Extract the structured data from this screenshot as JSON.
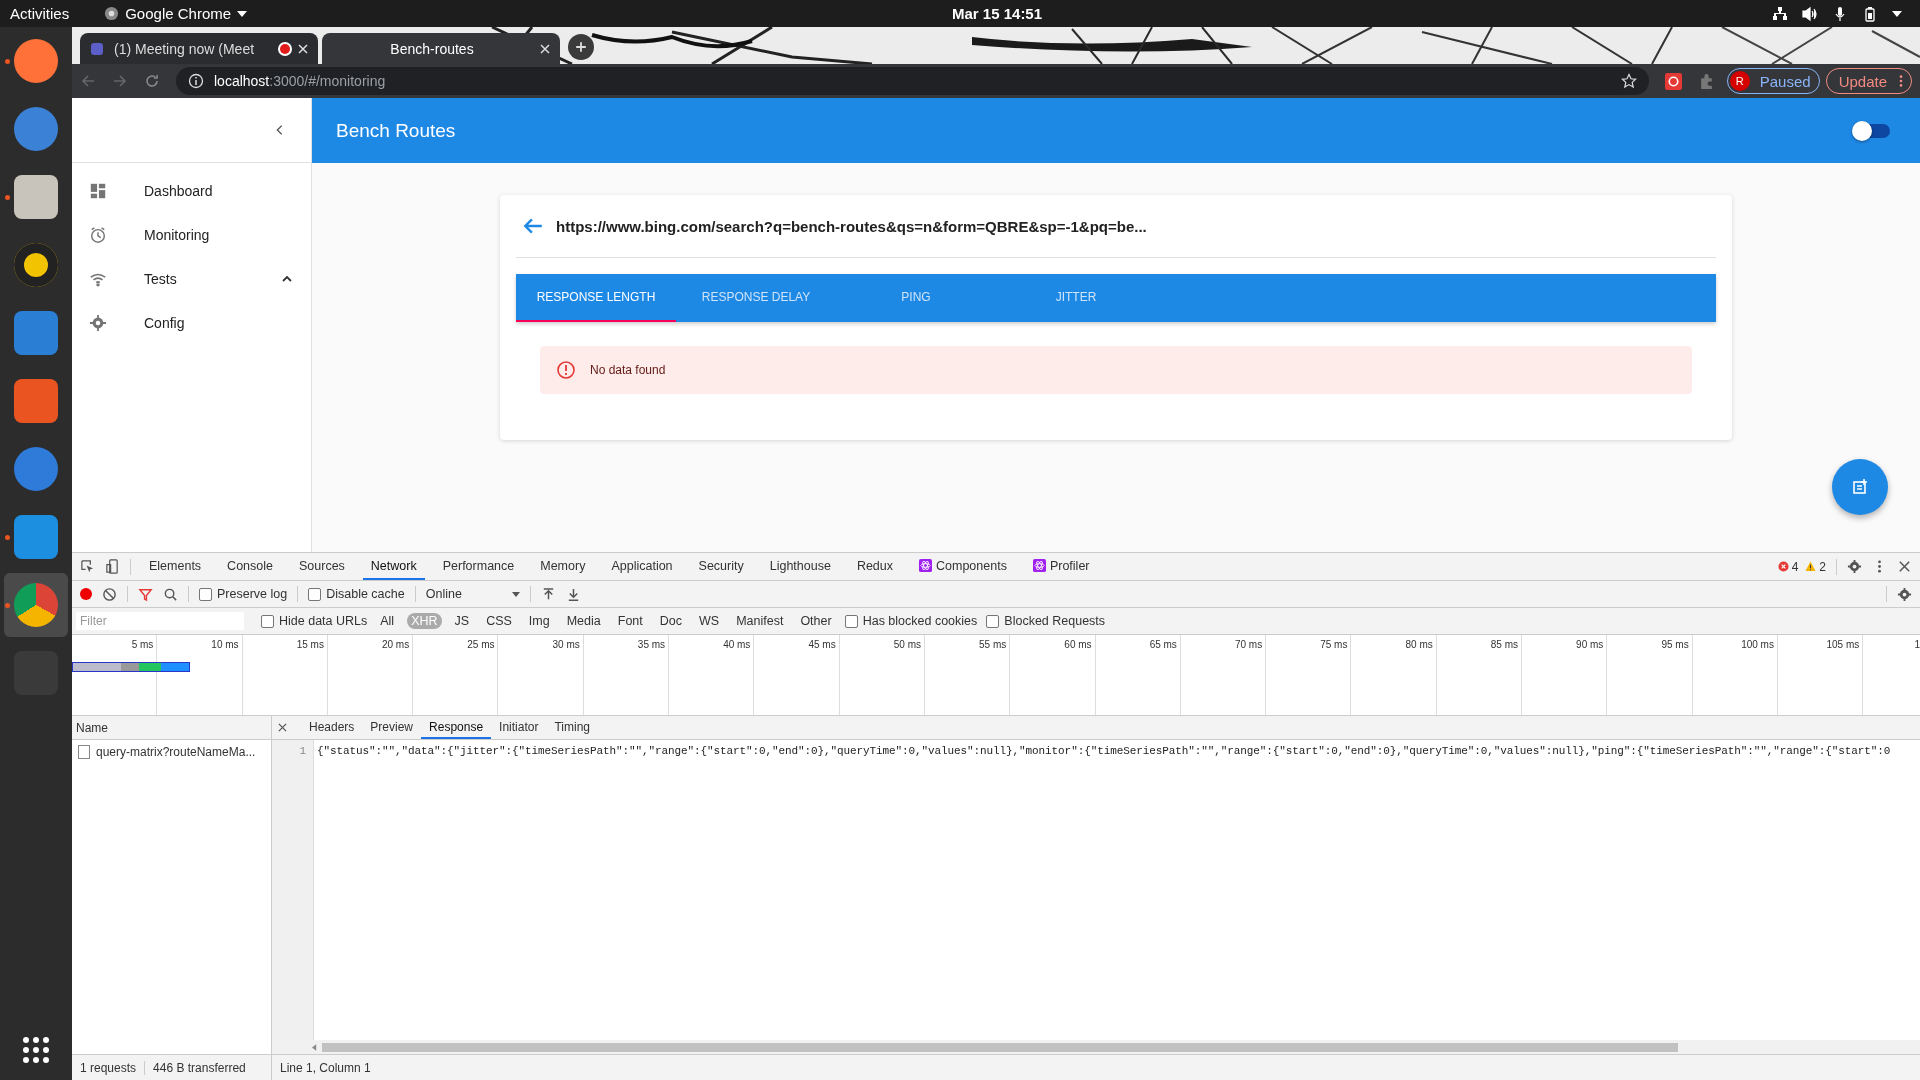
{
  "topbar": {
    "activities": "Activities",
    "app": "Google Chrome",
    "clock": "Mar 15  14:51"
  },
  "dock": [
    {
      "kind": "firefox",
      "running": true,
      "selected": false
    },
    {
      "kind": "mail",
      "running": false,
      "selected": false
    },
    {
      "kind": "files",
      "running": true,
      "selected": false
    },
    {
      "kind": "music",
      "running": false,
      "selected": false
    },
    {
      "kind": "writer",
      "running": false,
      "selected": false
    },
    {
      "kind": "store",
      "running": false,
      "selected": false
    },
    {
      "kind": "help",
      "running": false,
      "selected": false
    },
    {
      "kind": "code",
      "running": true,
      "selected": false
    },
    {
      "kind": "chrome",
      "running": true,
      "selected": true
    },
    {
      "kind": "terminal",
      "running": false,
      "selected": false
    }
  ],
  "browser": {
    "tabs": [
      {
        "title": "(1) Meeting now (Meet",
        "selected": false,
        "recording": true
      },
      {
        "title": "Bench-routes",
        "selected": true,
        "recording": false
      }
    ],
    "url_host": "localhost",
    "url_path": ":3000/#/monitoring",
    "profile_initial": "R",
    "profile_status": "Paused",
    "update": "Update"
  },
  "app": {
    "title": "Bench Routes",
    "toggle_on": false,
    "sidebar": [
      {
        "label": "Dashboard",
        "kind": "link"
      },
      {
        "label": "Monitoring",
        "kind": "link"
      },
      {
        "label": "Tests",
        "kind": "group",
        "expanded": true
      },
      {
        "label": "Config",
        "kind": "link"
      }
    ],
    "card": {
      "url": "https://www.bing.com/search?q=bench-routes&qs=n&form=QBRE&sp=-1&pq=be...",
      "tabs": [
        {
          "label": "RESPONSE LENGTH",
          "selected": true
        },
        {
          "label": "RESPONSE DELAY",
          "selected": false
        },
        {
          "label": "PING",
          "selected": false
        },
        {
          "label": "JITTER",
          "selected": false
        }
      ],
      "alert": "No data found"
    }
  },
  "devtools": {
    "panels": [
      {
        "label": "Elements",
        "kind": "plain",
        "selected": false
      },
      {
        "label": "Console",
        "kind": "plain",
        "selected": false
      },
      {
        "label": "Sources",
        "kind": "plain",
        "selected": false
      },
      {
        "label": "Network",
        "kind": "plain",
        "selected": true
      },
      {
        "label": "Performance",
        "kind": "plain",
        "selected": false
      },
      {
        "label": "Memory",
        "kind": "plain",
        "selected": false
      },
      {
        "label": "Application",
        "kind": "plain",
        "selected": false
      },
      {
        "label": "Security",
        "kind": "plain",
        "selected": false
      },
      {
        "label": "Lighthouse",
        "kind": "plain",
        "selected": false
      },
      {
        "label": "Redux",
        "kind": "plain",
        "selected": false
      },
      {
        "label": "Components",
        "kind": "react",
        "selected": false
      },
      {
        "label": "Profiler",
        "kind": "react",
        "selected": false
      }
    ],
    "errors": "4",
    "warnings": "2",
    "recording": true,
    "preserve_log": {
      "label": "Preserve log",
      "checked": false
    },
    "disable_cache": {
      "label": "Disable cache",
      "checked": false
    },
    "throttle": "Online",
    "filter_placeholder": "Filter",
    "hide_data_urls": {
      "label": "Hide data URLs",
      "checked": false
    },
    "types": [
      {
        "label": "All",
        "selected": false
      },
      {
        "label": "XHR",
        "selected": true
      },
      {
        "label": "JS",
        "selected": false
      },
      {
        "label": "CSS",
        "selected": false
      },
      {
        "label": "Img",
        "selected": false
      },
      {
        "label": "Media",
        "selected": false
      },
      {
        "label": "Font",
        "selected": false
      },
      {
        "label": "Doc",
        "selected": false
      },
      {
        "label": "WS",
        "selected": false
      },
      {
        "label": "Manifest",
        "selected": false
      },
      {
        "label": "Other",
        "selected": false
      }
    ],
    "has_blocked_cookies": {
      "label": "Has blocked cookies",
      "checked": false
    },
    "blocked_requests": {
      "label": "Blocked Requests",
      "checked": false
    },
    "ticks": [
      "5 ms",
      "10 ms",
      "15 ms",
      "20 ms",
      "25 ms",
      "30 ms",
      "35 ms",
      "40 ms",
      "45 ms",
      "50 ms",
      "55 ms",
      "60 ms",
      "65 ms",
      "70 ms",
      "75 ms",
      "80 ms",
      "85 ms",
      "90 ms",
      "95 ms",
      "100 ms",
      "105 ms",
      "1"
    ],
    "name_header": "Name",
    "requests": [
      {
        "name": "query-matrix?routeNameMa...",
        "selected": false
      }
    ],
    "detail_tabs": [
      {
        "label": "Headers",
        "selected": false
      },
      {
        "label": "Preview",
        "selected": false
      },
      {
        "label": "Response",
        "selected": true
      },
      {
        "label": "Initiator",
        "selected": false
      },
      {
        "label": "Timing",
        "selected": false
      }
    ],
    "response_lines": [
      {
        "number": "1",
        "text": "{\"status\":\"\",\"data\":{\"jitter\":{\"timeSeriesPath\":\"\",\"range\":{\"start\":0,\"end\":0},\"queryTime\":0,\"values\":null},\"monitor\":{\"timeSeriesPath\":\"\",\"range\":{\"start\":0,\"end\":0},\"queryTime\":0,\"values\":null},\"ping\":{\"timeSeriesPath\":\"\",\"range\":{\"start\":0"
      }
    ],
    "summary": [
      "1 requests",
      "446 B transferred"
    ],
    "cursor": "Line 1, Column 1"
  }
}
